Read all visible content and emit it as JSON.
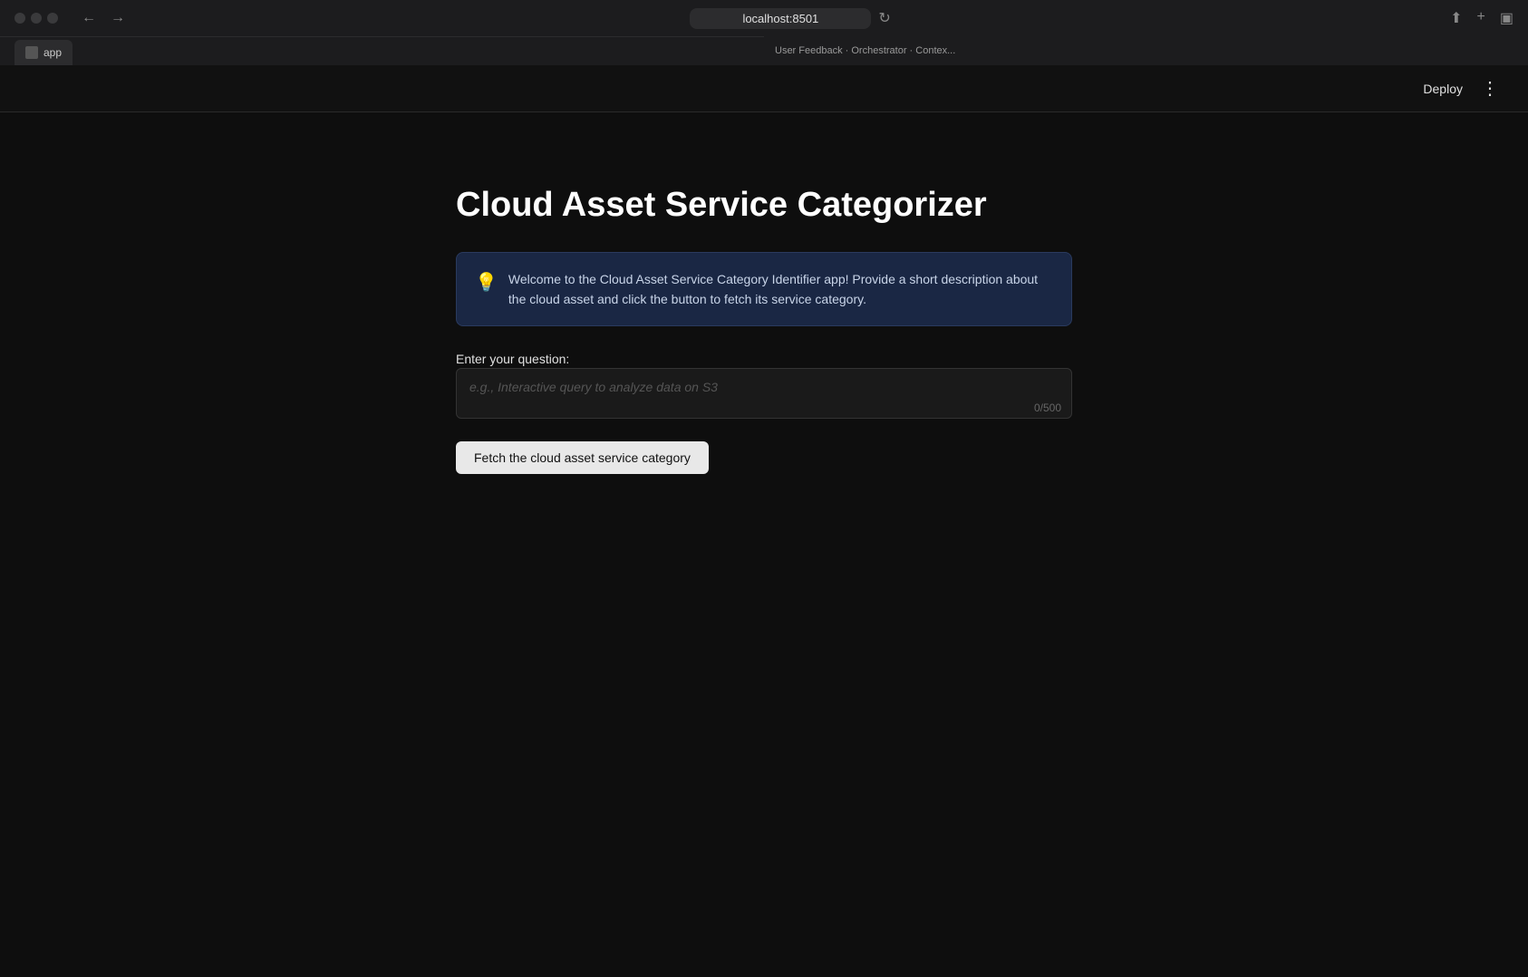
{
  "browser": {
    "address": "localhost:8501",
    "tab_label": "app",
    "secondary_tab_text": "User Feedback · Orchestrator · Contex..."
  },
  "app_header": {
    "deploy_label": "Deploy",
    "more_icon": "⋮"
  },
  "app": {
    "title": "Cloud Asset Service Categorizer",
    "info_banner": {
      "icon": "💡",
      "text": "Welcome to the Cloud Asset Service Category Identifier app! Provide a short description about the cloud asset and click the button to fetch its service category."
    },
    "question_label": "Enter your question:",
    "input_placeholder": "e.g., Interactive query to analyze data on S3",
    "input_value": "",
    "char_count": "0/500",
    "fetch_button_label": "Fetch the cloud asset service category"
  }
}
